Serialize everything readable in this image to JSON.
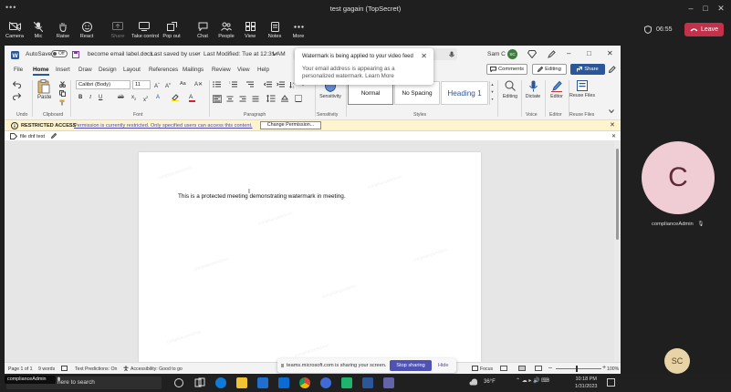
{
  "window": {
    "title": "test gagain (TopSecret)"
  },
  "meeting_toolbar": {
    "items": [
      {
        "label": "Camera",
        "icon": "camera-icon"
      },
      {
        "label": "Mic",
        "icon": "mic-icon"
      },
      {
        "label": "Raise",
        "icon": "raise-hand-icon"
      },
      {
        "label": "React",
        "icon": "react-icon"
      },
      {
        "label": "Share",
        "icon": "share-tray-icon"
      },
      {
        "label": "Take control",
        "icon": "take-control-icon"
      },
      {
        "label": "Pop out",
        "icon": "pop-out-icon"
      },
      {
        "label": "Chat",
        "icon": "chat-icon"
      },
      {
        "label": "People",
        "icon": "people-icon"
      },
      {
        "label": "View",
        "icon": "view-icon"
      },
      {
        "label": "Notes",
        "icon": "notes-icon"
      },
      {
        "label": "More",
        "icon": "more-icon"
      }
    ],
    "timer": "06:55",
    "leave_label": "Leave",
    "leave_color": "#c4314b"
  },
  "word": {
    "autosave_label": "AutoSave",
    "autosave_state": "Off",
    "filename": "become email label.docx",
    "saved_status": "Last saved by user",
    "last_modified": "Last Modified: Tue at 12:31 AM",
    "account": "Sam C",
    "account_initials": "SC",
    "editing_mode": "Editing",
    "comments_label": "Comments",
    "share_label": "Share",
    "share_color": "#2b579a",
    "tabs": [
      "File",
      "Home",
      "Insert",
      "Draw",
      "Design",
      "Layout",
      "References",
      "Mailings",
      "Review",
      "View",
      "Help"
    ],
    "active_tab": "Home",
    "font_name": "Calibri (Body)",
    "font_size": "11",
    "paste_label": "Paste",
    "sensitivity_label": "Sensitivity",
    "styles": [
      "Normal",
      "No Spacing",
      "Heading 1"
    ],
    "editing_label": "Editing",
    "dictate_label": "Dictate",
    "editor_label": "Editor",
    "reuse_label": "Reuse Files",
    "groups": [
      "Undo",
      "Clipboard",
      "Font",
      "Paragraph",
      "Sensitivity",
      "Styles",
      "Voice",
      "Editor",
      "Reuse Files"
    ],
    "restricted_title": "RESTRICTED ACCESS",
    "restricted_message": "Permission is currently restricted. Only specified users can access this content.",
    "change_permission_label": "Change Permission...",
    "file_tab_name": "file dnf test",
    "document_text": "This is a protected meeting demonstrating watermark in meeting.",
    "status": {
      "page": "Page 1 of 1",
      "words": "9 words",
      "predictions": "Text Predictions: On",
      "accessibility": "Accessibility: Good to go",
      "focus": "Focus",
      "zoom": "100%"
    }
  },
  "toast": {
    "heading": "Watermark is being applied to your video feed",
    "body": "Your email address is appearing as a personalized watermark. Learn More"
  },
  "sharing": {
    "message": "teams.microsoft.com is sharing your screen.",
    "stop_label": "Stop sharing",
    "hide_label": "Hide"
  },
  "taskbar": {
    "search_text": "here to search",
    "presenter_label": "complianceAdmin",
    "weather": "36°F",
    "time": "10:18 PM",
    "date": "1/31/2023"
  },
  "participants": {
    "main_initial": "C",
    "main_name": "complianceAdmin",
    "self_initials": "SC"
  }
}
